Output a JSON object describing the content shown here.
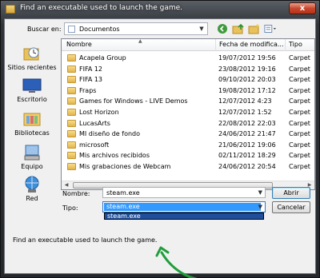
{
  "window": {
    "title": "Find an executable used to launch the game.",
    "close_label": "x"
  },
  "lookin": {
    "label": "Buscar en:",
    "value": "Documentos"
  },
  "places": [
    {
      "label": "Sitios recientes",
      "icon": "recent-places-icon"
    },
    {
      "label": "Escritorio",
      "icon": "desktop-icon"
    },
    {
      "label": "Bibliotecas",
      "icon": "libraries-icon"
    },
    {
      "label": "Equipo",
      "icon": "computer-icon"
    },
    {
      "label": "Red",
      "icon": "network-icon"
    }
  ],
  "columns": {
    "name": "Nombre",
    "date": "Fecha de modifica...",
    "type": "Tipo"
  },
  "files": [
    {
      "name": "Acapela Group",
      "date": "19/07/2012 19:56",
      "type": "Carpet"
    },
    {
      "name": "FIFA 12",
      "date": "23/08/2012 19:16",
      "type": "Carpet"
    },
    {
      "name": "FIFA 13",
      "date": "09/10/2012 20:03",
      "type": "Carpet"
    },
    {
      "name": "Fraps",
      "date": "19/08/2012 17:12",
      "type": "Carpet"
    },
    {
      "name": "Games for Windows - LIVE Demos",
      "date": "12/07/2012 4:23",
      "type": "Carpet"
    },
    {
      "name": "Lost Horizon",
      "date": "12/07/2012 1:52",
      "type": "Carpet"
    },
    {
      "name": "LucasArts",
      "date": "22/08/2012 22:03",
      "type": "Carpet"
    },
    {
      "name": "MI diseño de fondo",
      "date": "24/06/2012 21:47",
      "type": "Carpet"
    },
    {
      "name": "microsoft",
      "date": "21/06/2012 19:06",
      "type": "Carpet"
    },
    {
      "name": "Mis archivos recibidos",
      "date": "02/11/2012 18:29",
      "type": "Carpet"
    },
    {
      "name": "Mis grabaciones de Webcam",
      "date": "24/06/2012 20:54",
      "type": "Carpet"
    }
  ],
  "filename": {
    "label": "Nombre:",
    "value": "steam.exe"
  },
  "filetype": {
    "label": "Tipo:",
    "value": "steam.exe",
    "popup_option": "steam.exe"
  },
  "buttons": {
    "open": "Abrir",
    "cancel": "Cancelar"
  },
  "footer": {
    "text": "Find an executable used to launch the game."
  },
  "colors": {
    "annotation": "#1e9e3a",
    "selection": "#3399ff"
  }
}
